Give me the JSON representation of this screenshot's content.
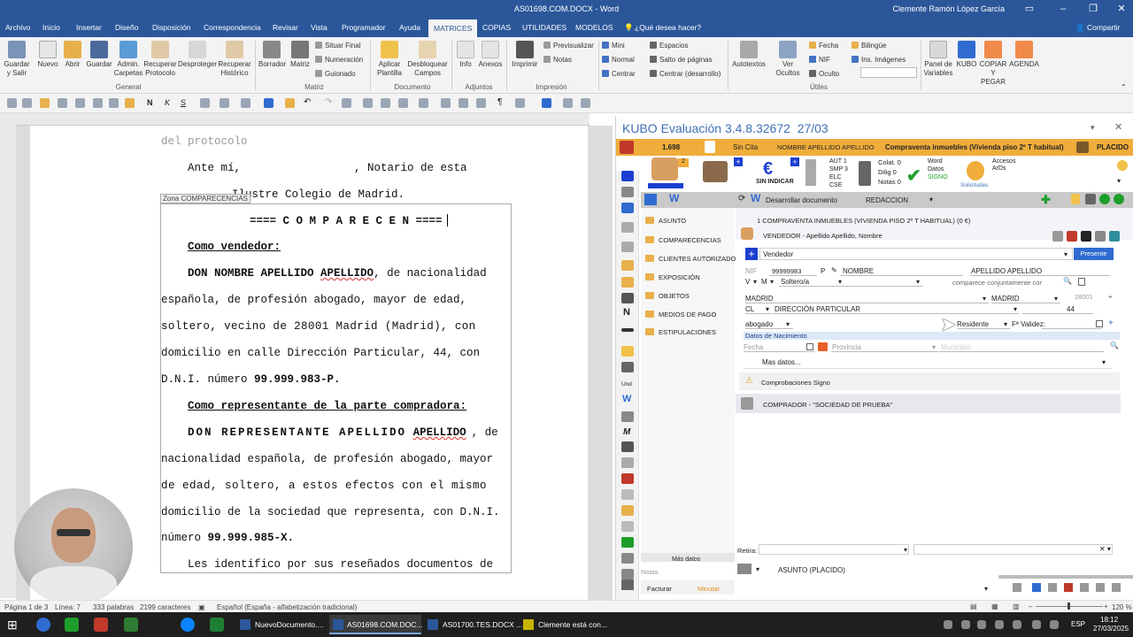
{
  "window": {
    "title": "AS01698.COM.DOCX  -  Word",
    "user": "Clemente Ramón López García"
  },
  "tabs": [
    "Archivo",
    "Inicio",
    "Insertar",
    "Diseño",
    "Disposición",
    "Correspondencia",
    "Revisar",
    "Vista",
    "Programador",
    "Ayuda",
    "MATRICES",
    "COPIAS",
    "UTILIDADES",
    "MODELOS",
    "¿Qué desea hacer?"
  ],
  "share_label": "Compartir",
  "ribbon": {
    "general": {
      "group": "General",
      "buttons": [
        "Guardar y Salir",
        "Nuevo",
        "Abrir",
        "Guardar",
        "Admin. Carpetas",
        "Recuperar Protocolo",
        "Desproteger",
        "Recuperar Histórico"
      ]
    },
    "matriz": {
      "group": "Matriz",
      "buttons": [
        "Borrador",
        "Matriz"
      ],
      "small": [
        "Situar Final",
        "Numeración",
        "Guionado"
      ]
    },
    "documento": {
      "group": "Documento",
      "buttons": [
        "Aplicar Plantilla",
        "Desbloquear Campos"
      ]
    },
    "adjuntos": {
      "group": "Adjuntos",
      "buttons": [
        "Info",
        "Anexos"
      ]
    },
    "impresion": {
      "group": "Impresión",
      "buttons": [
        "Imprimir"
      ],
      "small": [
        "Previsualizar",
        "Notas"
      ]
    },
    "formato": {
      "small": [
        "Mini",
        "Normal",
        "Centrar",
        "Espacios",
        "Salto de páginas",
        "Centrar (desarrollo)"
      ]
    },
    "utiles": {
      "group": "Útiles",
      "buttons": [
        "Autotextos",
        "Ver Ocultos"
      ],
      "small": [
        "Fecha",
        "NIF",
        "Oculto",
        "Bilingüe",
        "Ins. Imágenes"
      ]
    },
    "extra": {
      "buttons": [
        "Panel de Variables",
        "KUBO",
        "COPIAR Y PEGAR",
        "AGENDA"
      ]
    }
  },
  "document": {
    "zone_label": "Zona COMPARECENCIAS",
    "lines": {
      "l0": "del protocolo",
      "l1a": "Ante mí,",
      "l1b": ", Notario de esta",
      "l2": "Ilustre Colegio de Madrid.",
      "l3": "==== C O M P A R E C E N ====",
      "l4": "Como vendedor:",
      "l5a": "DON NOMBRE APELLIDO",
      "l5b": "APELLIDO",
      "l5c": ", de nacionalidad",
      "l6": "española, de profesión abogado, mayor de edad,",
      "l7": "soltero, vecino de 28001 Madrid (Madrid), con",
      "l8": "domicilio en calle Dirección Particular, 44, con",
      "l9a": "D.N.I. número",
      "l9b": "99.999.983-P.",
      "l10": "Como representante de la parte compradora:",
      "l11a": "DON REPRESENTANTE APELLIDO",
      "l11b": "APELLIDO",
      "l11c": ", de",
      "l12": "nacionalidad española, de profesión abogado, mayor",
      "l13": "de edad, soltero, a estos efectos con el mismo",
      "l14": "domicilio de la sociedad que representa, con D.N.I.",
      "l15a": "número",
      "l15b": "99.999.985-X.",
      "l16": "Les identifico por sus reseñados documentos de"
    }
  },
  "status": {
    "page": "Página 1 de 3",
    "line": "Línea: 7",
    "words": "333 palabras",
    "chars": "2199 caracteres",
    "lang": "Español (España - alfabetización tradicional)",
    "zoom": "120 %"
  },
  "kubo": {
    "title": "KUBO Evaluación 3.4.8.32672",
    "date": "27/03",
    "bar": {
      "num": "1.698",
      "cita": "Sin Cita",
      "name": "NOMBRE APELLIDO APELLIDO",
      "desc": "Compraventa inmuebles (Vivienda piso 2º T habitual)",
      "state": "PLACIDO"
    },
    "icons": {
      "sin_indicar": "SIN INDICAR",
      "aut": "AUT 1",
      "smp": "SMP 3",
      "elc": "ELC",
      "cse": "CSE",
      "colat": "Colat. 0",
      "dilig": "Dilig 0",
      "notas": "Notas 0",
      "word": "Word",
      "datos": "Datos",
      "signo": "SIGNO",
      "solicitudes": "Solicitudes",
      "accesos": "Accesos ArDs"
    },
    "toolbar": {
      "desarrollar": "Desarrollar documento",
      "redaccion": "REDACCION"
    },
    "nav": [
      "ASUNTO",
      "COMPARECENCIAS",
      "CLIENTES AUTORIZADOS",
      "EXPOSICIÓN",
      "OBJETOS",
      "MEDIOS DE PAGO",
      "ESTIPULACIONES"
    ],
    "main": {
      "header": "1 COMPRAVENTA INMUEBLES (VIVIENDA PISO 2º T HABITUAL) (0 €)",
      "vendedor_line": "VENDEDOR - Apellido Apellido, Nombre",
      "role": "Vendedor",
      "presente": "Presente",
      "nif_label": "NIF",
      "nif": "99999983",
      "nif_letter": "P",
      "nombre": "NOMBRE",
      "apellidos": "APELLIDO APELLIDO",
      "sexo": "V",
      "estado_pref": "M",
      "estado": "Soltero/a",
      "comparece": "comparece conjuntamente cor",
      "ciudad": "MADRID",
      "provincia": "MADRID",
      "cp": "28001",
      "via": "CL",
      "direccion": "DIRECCIÓN PARTICULAR",
      "numero": "44",
      "profesion": "abogado",
      "residente": "Residente",
      "validez": "Fª Validez:",
      "nacimiento": "Datos de Nacimiento",
      "fecha": "Fecha",
      "prov_ph": "Provincia",
      "muni_ph": "Municipio",
      "mas_datos": "Mas datos...",
      "comprobaciones": "Comprobaciones Signo",
      "comprador": "COMPRADOR - \"SOCIEDAD DE PRUEBA\""
    },
    "bottom": {
      "mas_datos": "Más datos",
      "notas": "Notas",
      "retira": "Retira:",
      "asunto": "ASUNTO (PLACIDO)",
      "facturar": "Facturar",
      "minutar": "Minutar"
    }
  },
  "taskbar": {
    "apps": [
      "NuevoDocumento....",
      "AS01698.COM.DOC...",
      "AS01700.TES.DOCX ...",
      "Clemente está con..."
    ],
    "lang": "ESP",
    "time": "18:12",
    "date": "27/03/2025"
  },
  "colors": {
    "word_blue": "#2b579a",
    "kubo_orange": "#f0ad3c",
    "kubo_blue": "#3f6fb5"
  }
}
